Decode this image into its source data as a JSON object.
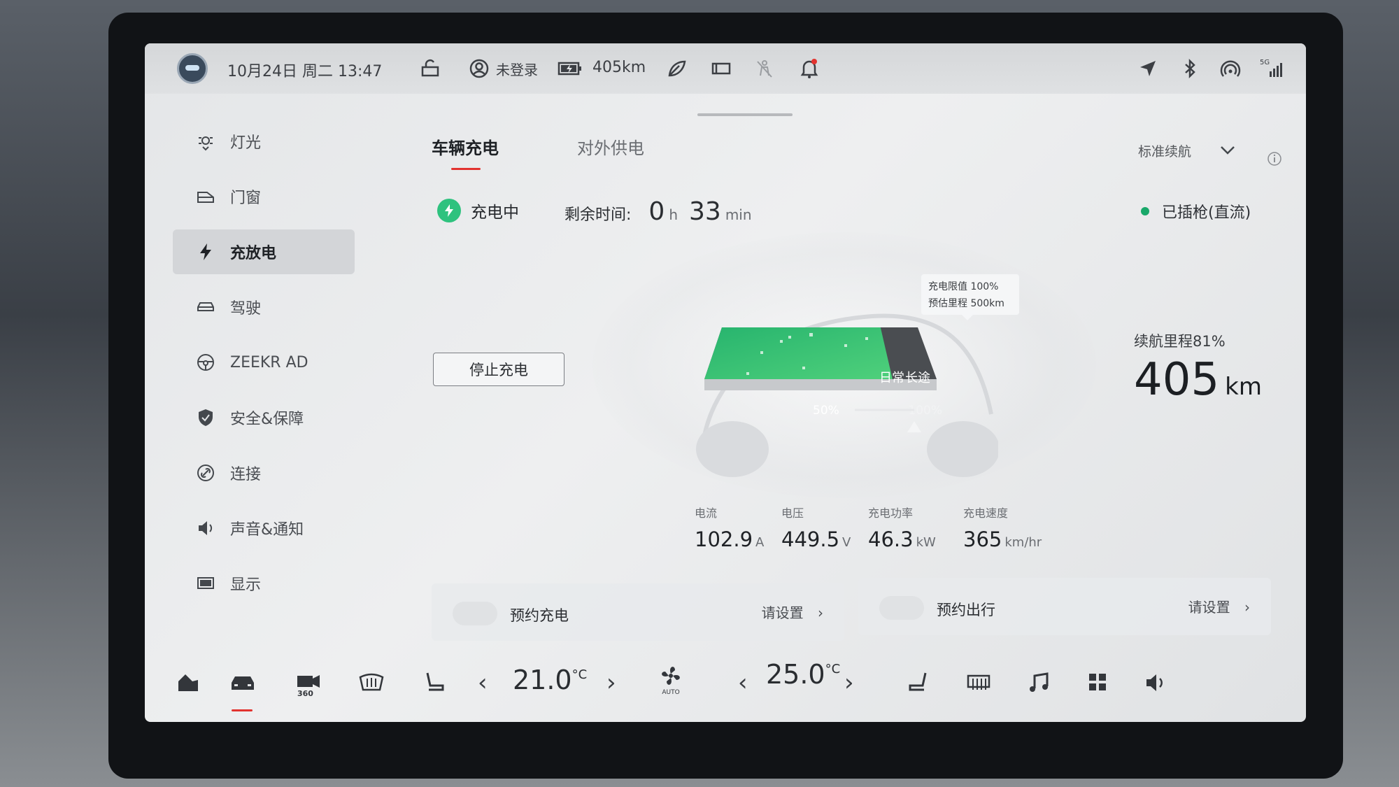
{
  "statusbar": {
    "datetime": "10月24日 周二 13:47",
    "user": "未登录",
    "battery_range": "405km",
    "signal": "5G"
  },
  "sidebar": {
    "items": [
      {
        "label": "灯光",
        "icon": "headlight-icon"
      },
      {
        "label": "门窗",
        "icon": "car-door-icon"
      },
      {
        "label": "充放电",
        "icon": "lightning-icon"
      },
      {
        "label": "驾驶",
        "icon": "car-icon"
      },
      {
        "label": "ZEEKR AD",
        "icon": "steering-wheel-icon"
      },
      {
        "label": "安全&保障",
        "icon": "shield-icon"
      },
      {
        "label": "连接",
        "icon": "link-icon"
      },
      {
        "label": "声音&通知",
        "icon": "speaker-icon"
      },
      {
        "label": "显示",
        "icon": "display-icon"
      }
    ],
    "active_index": 2
  },
  "tabs": [
    {
      "label": "车辆充电",
      "active": true
    },
    {
      "label": "对外供电",
      "active": false
    }
  ],
  "mode_select": {
    "value": "标准续航"
  },
  "charge": {
    "status": "充电中",
    "remaining_label": "剩余时间:",
    "hours": "0",
    "hours_unit": "h",
    "minutes": "33",
    "minutes_unit": "min",
    "plug_status": "已插枪(直流)",
    "stop_button": "停止充电"
  },
  "battery": {
    "level_fraction": 0.81,
    "limit_label": "充电限值 100%",
    "est_range_label": "预估里程 500km",
    "scale_min": "50%",
    "scale_max": "100%",
    "mode_daily": "日常",
    "mode_long": "长途"
  },
  "range": {
    "label": "续航里程81%",
    "value": "405",
    "unit": "km"
  },
  "metrics": [
    {
      "label": "电流",
      "value": "102.9",
      "unit": "A"
    },
    {
      "label": "电压",
      "value": "449.5",
      "unit": "V"
    },
    {
      "label": "充电功率",
      "value": "46.3",
      "unit": "kW"
    },
    {
      "label": "充电速度",
      "value": "365",
      "unit": "km/hr"
    }
  ],
  "schedule": [
    {
      "title": "预约充电",
      "action": "请设置"
    },
    {
      "title": "预约出行",
      "action": "请设置"
    }
  ],
  "climate": {
    "left_temp": "21.0",
    "right_temp": "25.0",
    "unit": "°C",
    "fan_mode": "AUTO"
  },
  "colors": {
    "accent": "#e2332f",
    "charge_green": "#2ec27e",
    "plugged_dot": "#19a86a"
  }
}
